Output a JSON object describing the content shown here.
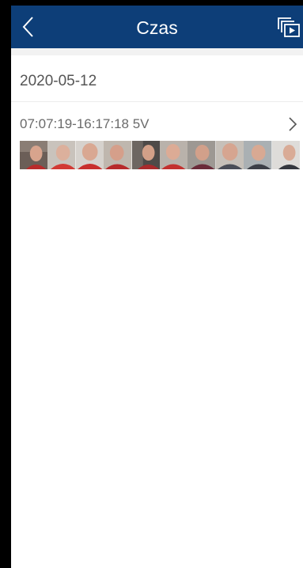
{
  "header": {
    "title": "Czas",
    "back_icon": "chevron-left-icon",
    "playlist_icon": "playlist-play-icon",
    "background_color": "#0d3e78"
  },
  "content": {
    "date": "2020-05-12",
    "records": [
      {
        "label": "07:07:19-16:17:18 5V",
        "chevron_icon": "chevron-right-icon",
        "thumbnail_count": 10
      }
    ]
  }
}
